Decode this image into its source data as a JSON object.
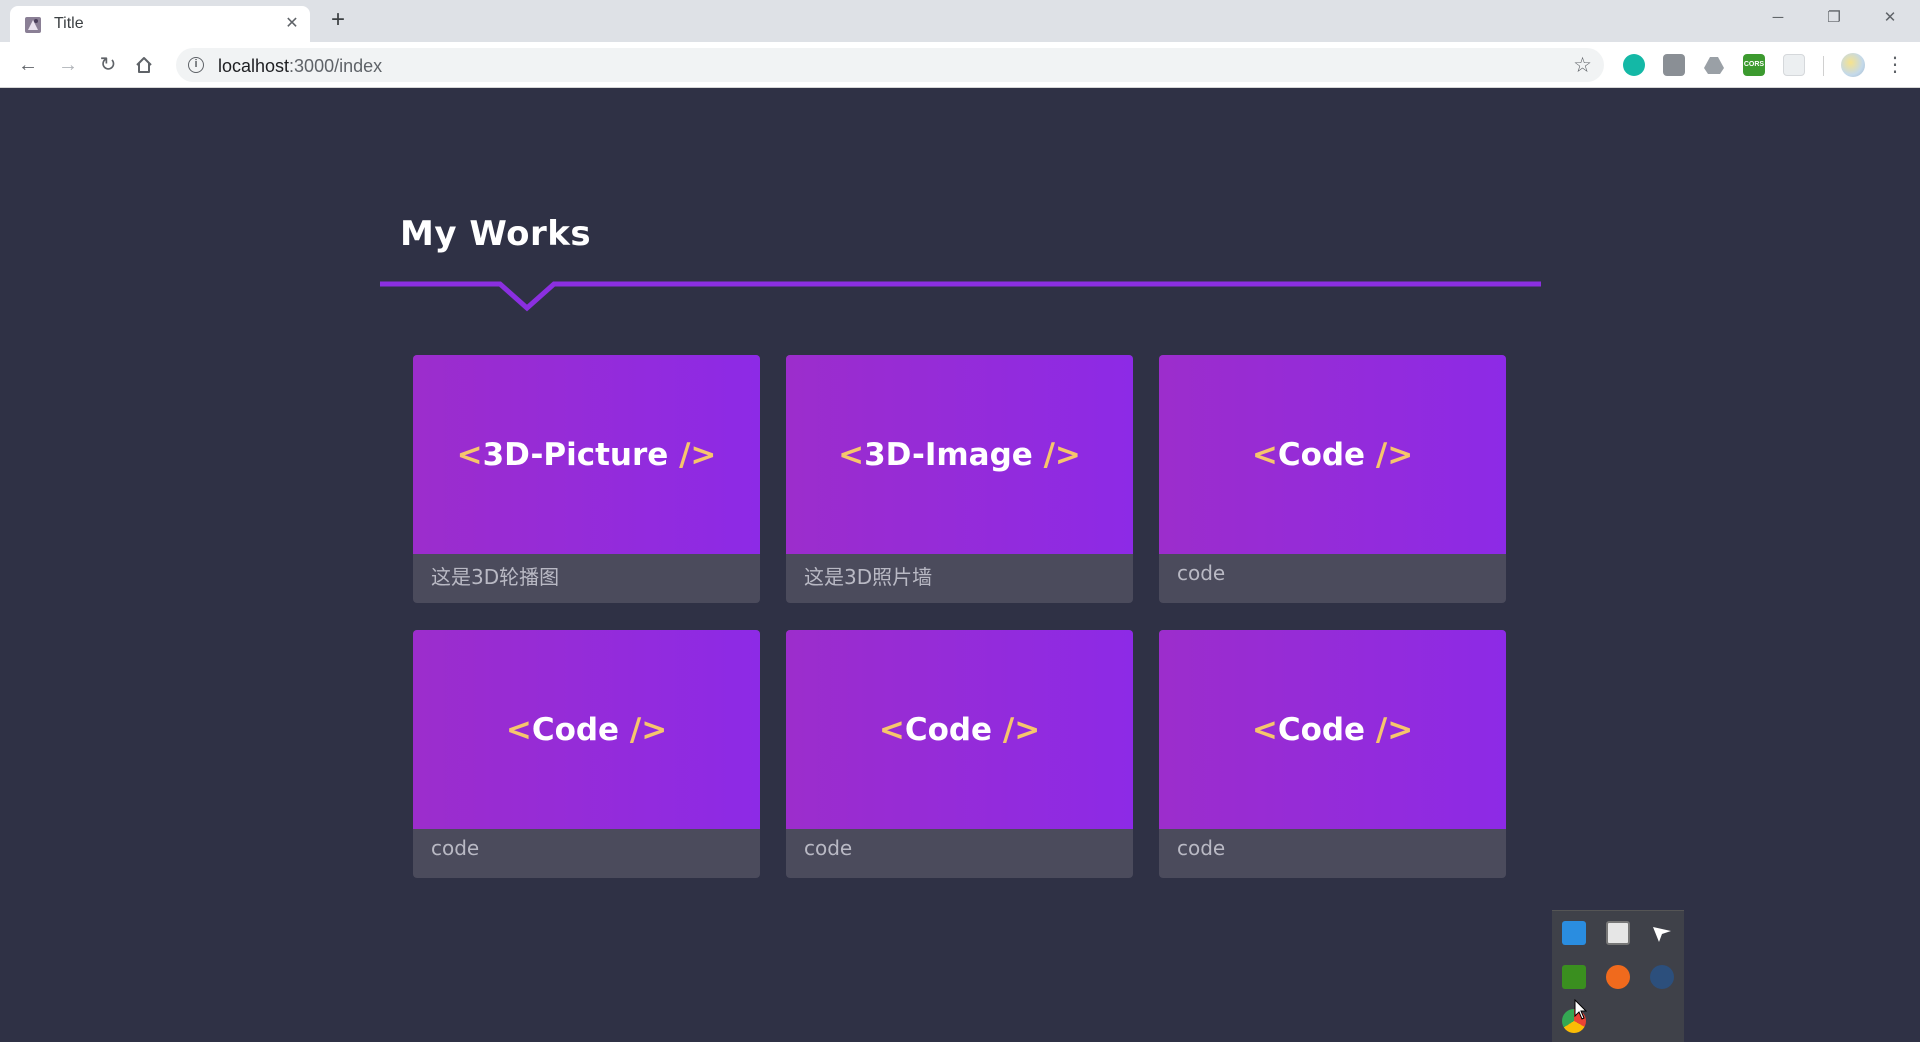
{
  "browser": {
    "tab_title": "Title",
    "url_host": "localhost",
    "url_rest": ":3000/index",
    "extensions": [
      "grammar-extension-icon",
      "puzzle-extension-icon",
      "drive-extension-icon",
      "cors-extension-icon",
      "blank-extension-icon",
      "profile-icon"
    ],
    "cors_label": "CORS"
  },
  "page": {
    "section_title": "My Works",
    "accent_color": "#8b2fe0",
    "cards": [
      {
        "open": "<",
        "name": "3D-Picture",
        "close": "/>",
        "desc": "这是3D轮播图"
      },
      {
        "open": "<",
        "name": "3D-Image",
        "close": "/>",
        "desc": "这是3D照片墙"
      },
      {
        "open": "<",
        "name": "Code",
        "close": "/>",
        "desc": "code"
      },
      {
        "open": "<",
        "name": "Code",
        "close": "/>",
        "desc": "code"
      },
      {
        "open": "<",
        "name": "Code",
        "close": "/>",
        "desc": "code"
      },
      {
        "open": "<",
        "name": "Code",
        "close": "/>",
        "desc": "code"
      }
    ]
  },
  "tray": {
    "icons": [
      "network-icon",
      "window-icon",
      "pointer-app-icon",
      "nvidia-icon",
      "origin-icon",
      "steam-icon",
      "chrome-icon"
    ]
  }
}
